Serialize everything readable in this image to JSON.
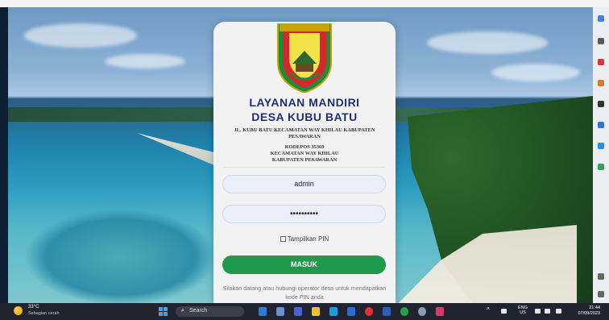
{
  "login": {
    "title_line1": "LAYANAN MANDIRI",
    "title_line2": "DESA KUBU BATU",
    "address_line1": "JL. KUBU BATU KECAMATAN WAY KHILAU KABUPATEN PESAWARAN",
    "address_line2": "KODEPOS 35369",
    "address_line3": "KECAMATAN WAY KHILAU",
    "address_line4": "KABUPATEN PESAWARAN",
    "username_value": "admin",
    "pin_value": "••••••••••",
    "show_pin_label": "Tampilkan PIN",
    "submit_label": "MASUK",
    "footer_text": "Silakan datang atau hubungi operator desa untuk mendapatkan kode PIN anda",
    "logo_text": "PESAWARAN"
  },
  "taskbar": {
    "weather_temp": "33°C",
    "weather_desc": "Sebagian cerah",
    "search_label": "Search",
    "lang_line1": "ENG",
    "lang_line2": "US",
    "time": "21:44",
    "date": "07/09/2023"
  },
  "colors": {
    "accent_button": "#1f9a4c",
    "title_text": "#1b2a7a",
    "taskbar": "#1f2430"
  }
}
